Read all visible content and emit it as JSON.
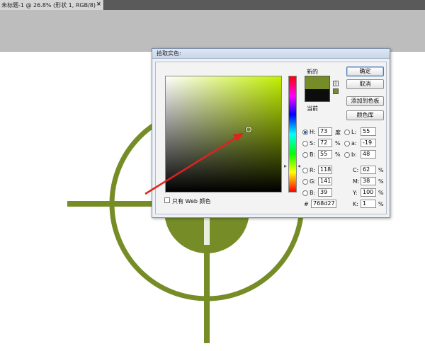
{
  "document_tab": {
    "title": "未标题-1 @ 26.8% (形状 1, RGB/8) *",
    "close_glyph": "×"
  },
  "colors": {
    "artwork": "#768d27",
    "new_color": "#768d27",
    "current_color": "#0d0d0d",
    "arrow": "#e0231f"
  },
  "dialog": {
    "title": "拾取实色:",
    "new_label": "新的",
    "current_label": "当前",
    "buttons": {
      "ok": "确定",
      "cancel": "取消",
      "add_to_swatches": "添加到色板",
      "color_libraries": "颜色库"
    },
    "web_only_label": "只有 Web 颜色",
    "hsb": [
      {
        "label": "H:",
        "value": "73",
        "unit": "度",
        "selected": true
      },
      {
        "label": "S:",
        "value": "72",
        "unit": "%",
        "selected": false
      },
      {
        "label": "B:",
        "value": "55",
        "unit": "%",
        "selected": false
      }
    ],
    "rgb": [
      {
        "label": "R:",
        "value": "118"
      },
      {
        "label": "G:",
        "value": "141"
      },
      {
        "label": "B:",
        "value": "39"
      }
    ],
    "lab": [
      {
        "label": "L:",
        "value": "55"
      },
      {
        "label": "a:",
        "value": "-19"
      },
      {
        "label": "b:",
        "value": "48"
      }
    ],
    "cmyk": [
      {
        "label": "C:",
        "value": "62",
        "unit": "%"
      },
      {
        "label": "M:",
        "value": "38",
        "unit": "%"
      },
      {
        "label": "Y:",
        "value": "100",
        "unit": "%"
      },
      {
        "label": "K:",
        "value": "1",
        "unit": "%"
      }
    ],
    "hex_label": "#",
    "hex_value": "768d27"
  }
}
